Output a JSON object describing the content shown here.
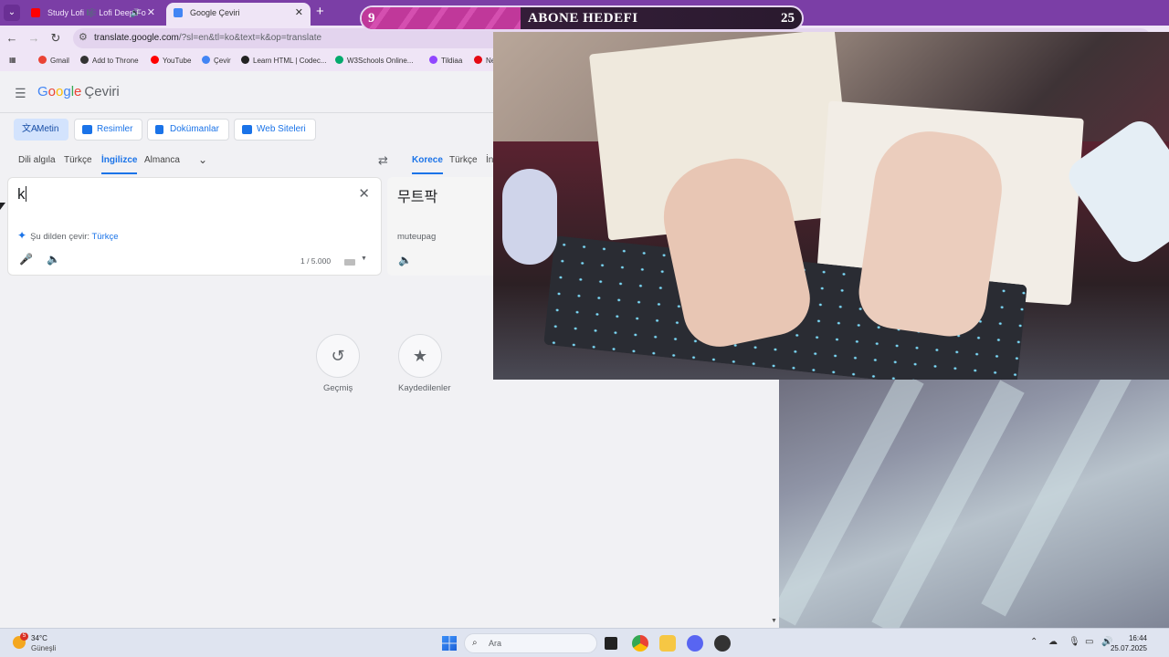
{
  "browser": {
    "tabs": [
      {
        "title": "Study Lofi 🎼 Lofi Deep Fo",
        "active": false,
        "favicon_color": "#ff0000"
      },
      {
        "title": "Google Çeviri",
        "active": true,
        "favicon_color": "#4285f4"
      }
    ],
    "url_host": "translate.google.com",
    "url_rest": "/?sl=en&tl=ko&text=k&op=translate",
    "bookmarks": [
      "Gmail",
      "Add to Throne",
      "YouTube",
      "Çevir",
      "Learn HTML | Codec...",
      "W3Schools Online...",
      "Tildiaa",
      "Ne"
    ]
  },
  "translate": {
    "product_name": "Çeviri",
    "logo_letters": [
      "G",
      "o",
      "o",
      "g",
      "l",
      "e"
    ],
    "modes": [
      "Metin",
      "Resimler",
      "Dokümanlar",
      "Web Siteleri"
    ],
    "source_langs": [
      "Dili algıla",
      "Türkçe",
      "İngilizce",
      "Almanca"
    ],
    "target_langs": [
      "Korece",
      "Türkçe",
      "İn"
    ],
    "source_text": "k",
    "detect_prefix": "Şu dilden çevir:",
    "detect_lang": "Türkçe",
    "char_count": "1 / 5.000",
    "target_text": "무트팍",
    "transliteration": "muteupag",
    "history_label": "Geçmiş",
    "saved_label": "Kaydedilenler"
  },
  "overlay": {
    "goal_current": "9",
    "goal_title": "ABONE HEDEFI",
    "goal_target": "25",
    "goal_progress": 0.36
  },
  "taskbar": {
    "weather_badge": "5",
    "temperature": "34°C",
    "condition": "Güneşli",
    "search_placeholder": "Ara",
    "time": "16:44",
    "date": "25.07.2025"
  }
}
